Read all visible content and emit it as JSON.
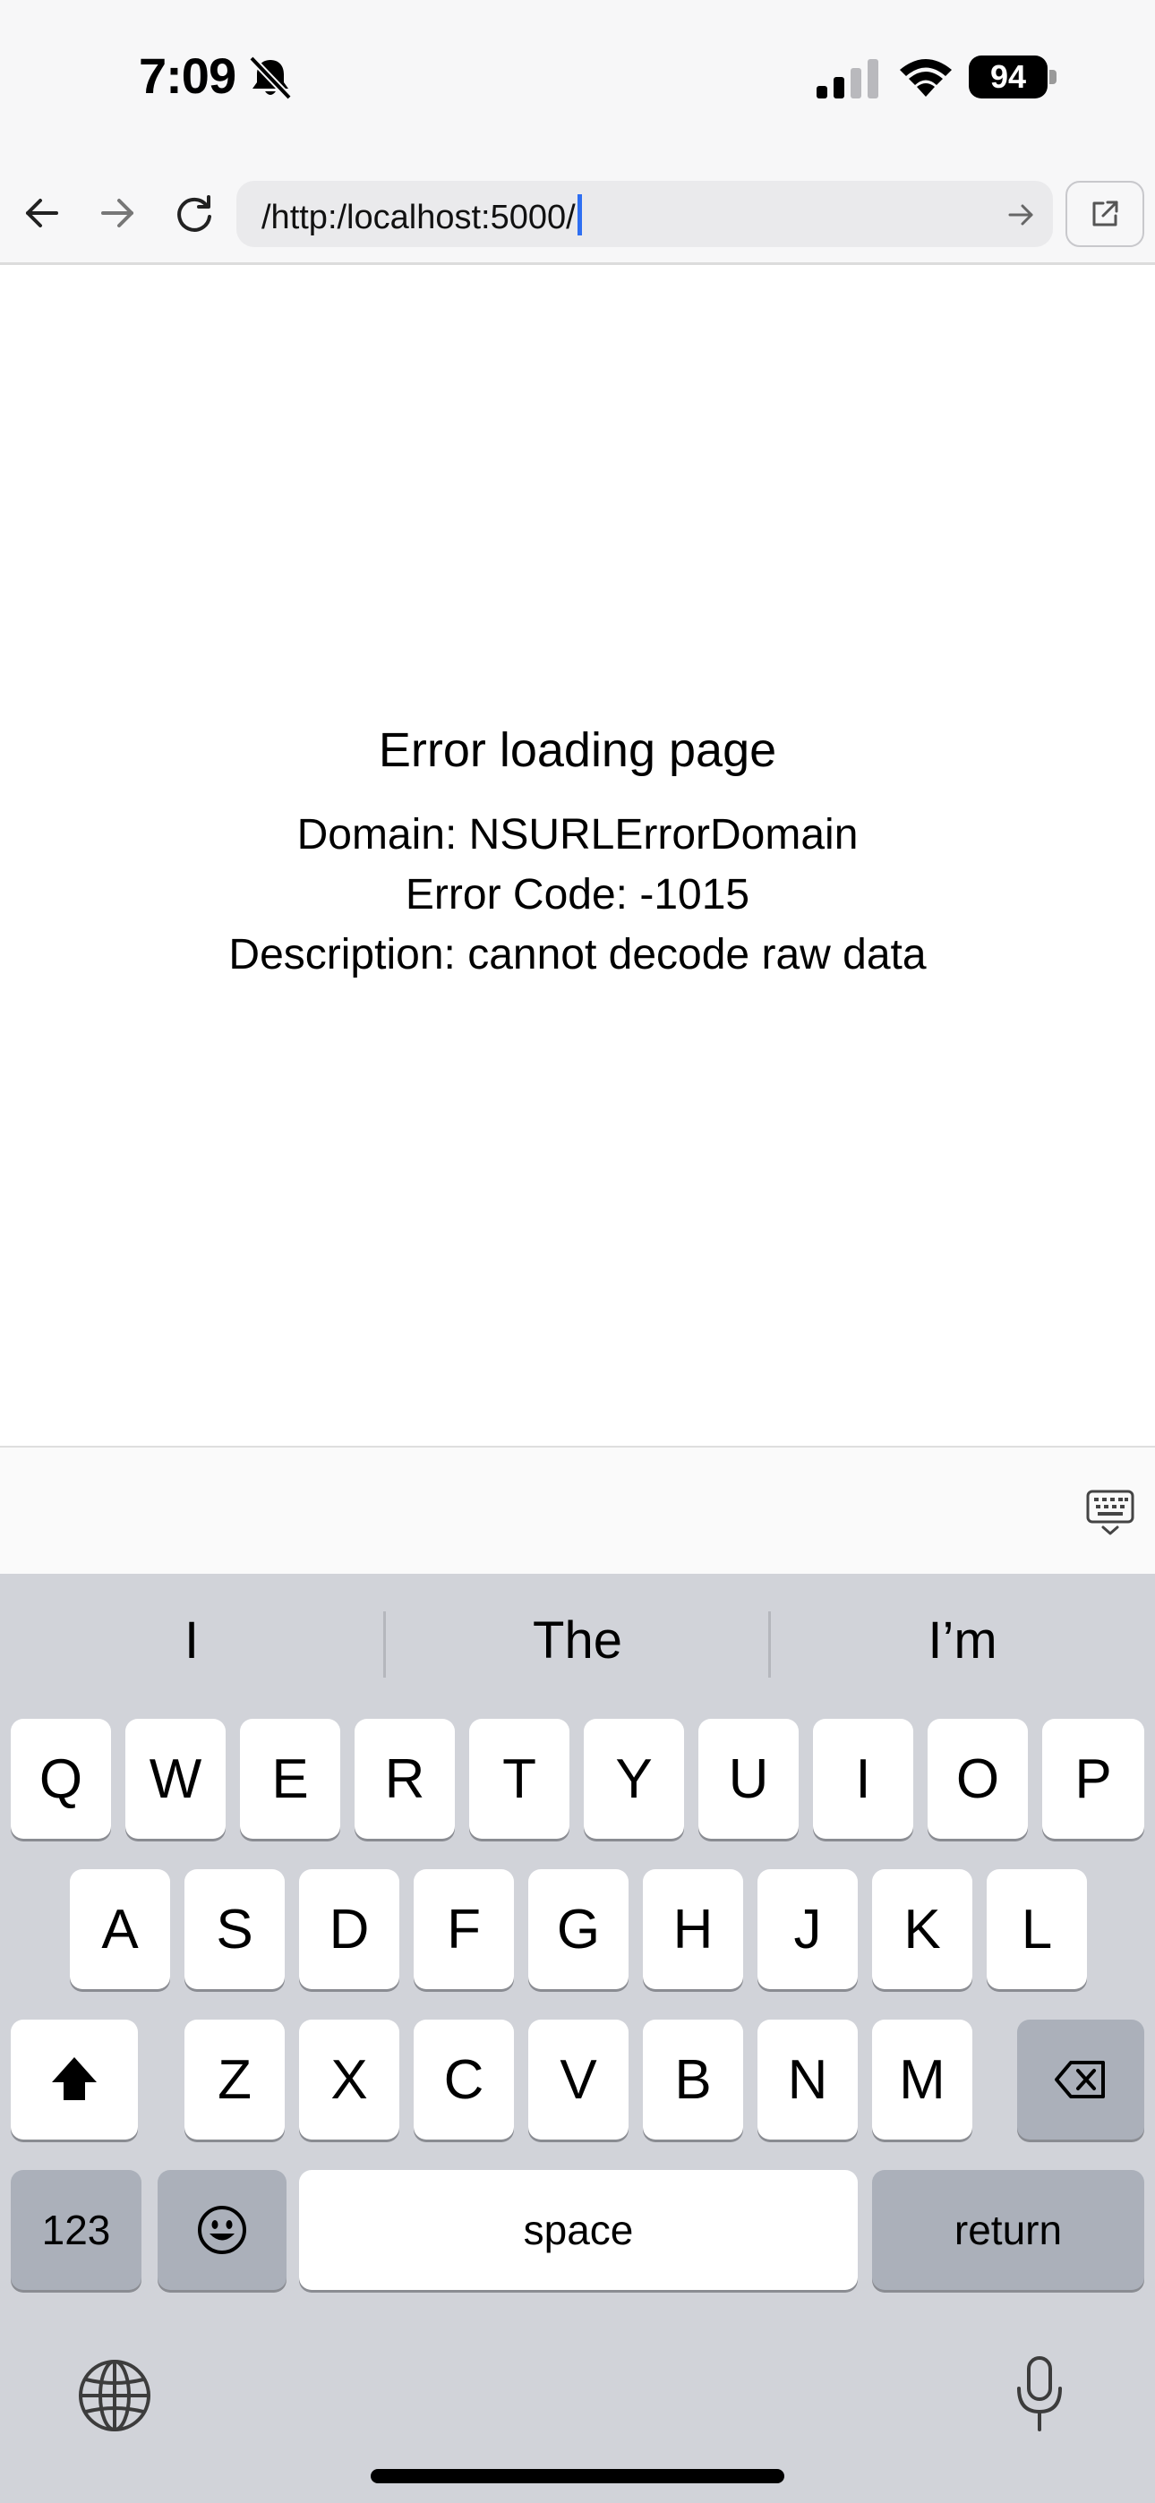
{
  "status_bar": {
    "time": "7:09",
    "battery": "94"
  },
  "toolbar": {
    "url": "/http:/localhost:5000/"
  },
  "error": {
    "title": "Error loading page",
    "domain_line": "Domain: NSURLErrorDomain",
    "code_line": "Error Code: -1015",
    "description_line": "Description: cannot decode raw data"
  },
  "keyboard": {
    "predictions": [
      "I",
      "The",
      "I’m"
    ],
    "row1": [
      "Q",
      "W",
      "E",
      "R",
      "T",
      "Y",
      "U",
      "I",
      "O",
      "P"
    ],
    "row2": [
      "A",
      "S",
      "D",
      "F",
      "G",
      "H",
      "J",
      "K",
      "L"
    ],
    "row3": [
      "Z",
      "X",
      "C",
      "V",
      "B",
      "N",
      "M"
    ],
    "numbers_label": "123",
    "space_label": "space",
    "return_label": "return"
  }
}
